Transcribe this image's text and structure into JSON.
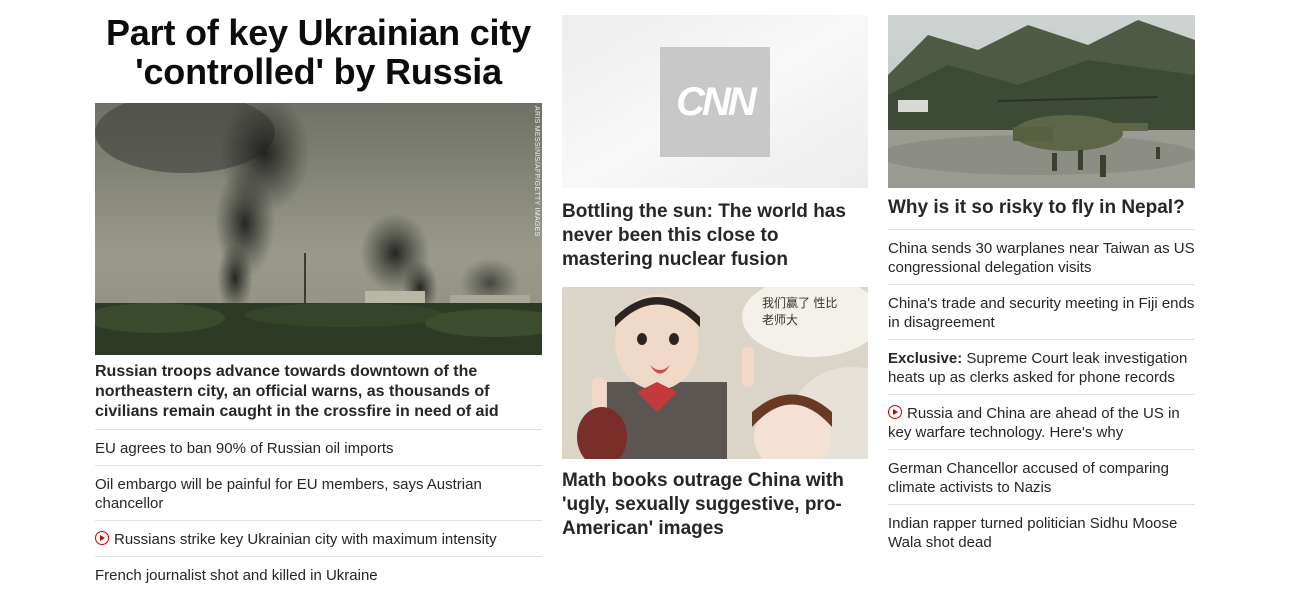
{
  "left": {
    "headline": "Part of key Ukrainian city 'controlled' by Russia",
    "image_credit": "ARIS MESSINIS/AFP/GETTY IMAGES",
    "summary": "Russian troops advance towards downtown of the northeastern city, an official warns, as thousands of civilians remain caught in the crossfire in need of aid",
    "links": [
      {
        "text": "EU agrees to ban 90% of Russian oil imports"
      },
      {
        "text": "Oil embargo will be painful for EU members, says Austrian chancellor"
      },
      {
        "text": "Russians strike key Ukrainian city with maximum intensity",
        "icon": "play-icon"
      },
      {
        "text": "French journalist shot and killed in Ukraine"
      }
    ]
  },
  "middle": {
    "story1": {
      "logo": "CNN",
      "headline": "Bottling the sun: The world has never been this close to mastering nuclear fusion"
    },
    "story2": {
      "bubble_text": "我们赢了 性比老师大",
      "headline": "Math books outrage China with 'ugly, sexually suggestive, pro-American' images"
    }
  },
  "right": {
    "headline": "Why is it so risky to fly in Nepal?",
    "links": [
      {
        "text": "China sends 30 warplanes near Taiwan as US congressional delegation visits"
      },
      {
        "text": "China's trade and security meeting in Fiji ends in disagreement"
      },
      {
        "kicker": "Exclusive:",
        "text": "Supreme Court leak investigation heats up as clerks asked for phone records"
      },
      {
        "text": "Russia and China are ahead of the US in key warfare technology. Here's why",
        "icon": "play-icon"
      },
      {
        "text": "German Chancellor accused of comparing climate activists to Nazis"
      },
      {
        "text": "Indian rapper turned politician Sidhu Moose Wala shot dead"
      }
    ]
  },
  "colors": {
    "text": "#262626",
    "divider": "#e0e0e0",
    "video_red": "#cc0000"
  }
}
